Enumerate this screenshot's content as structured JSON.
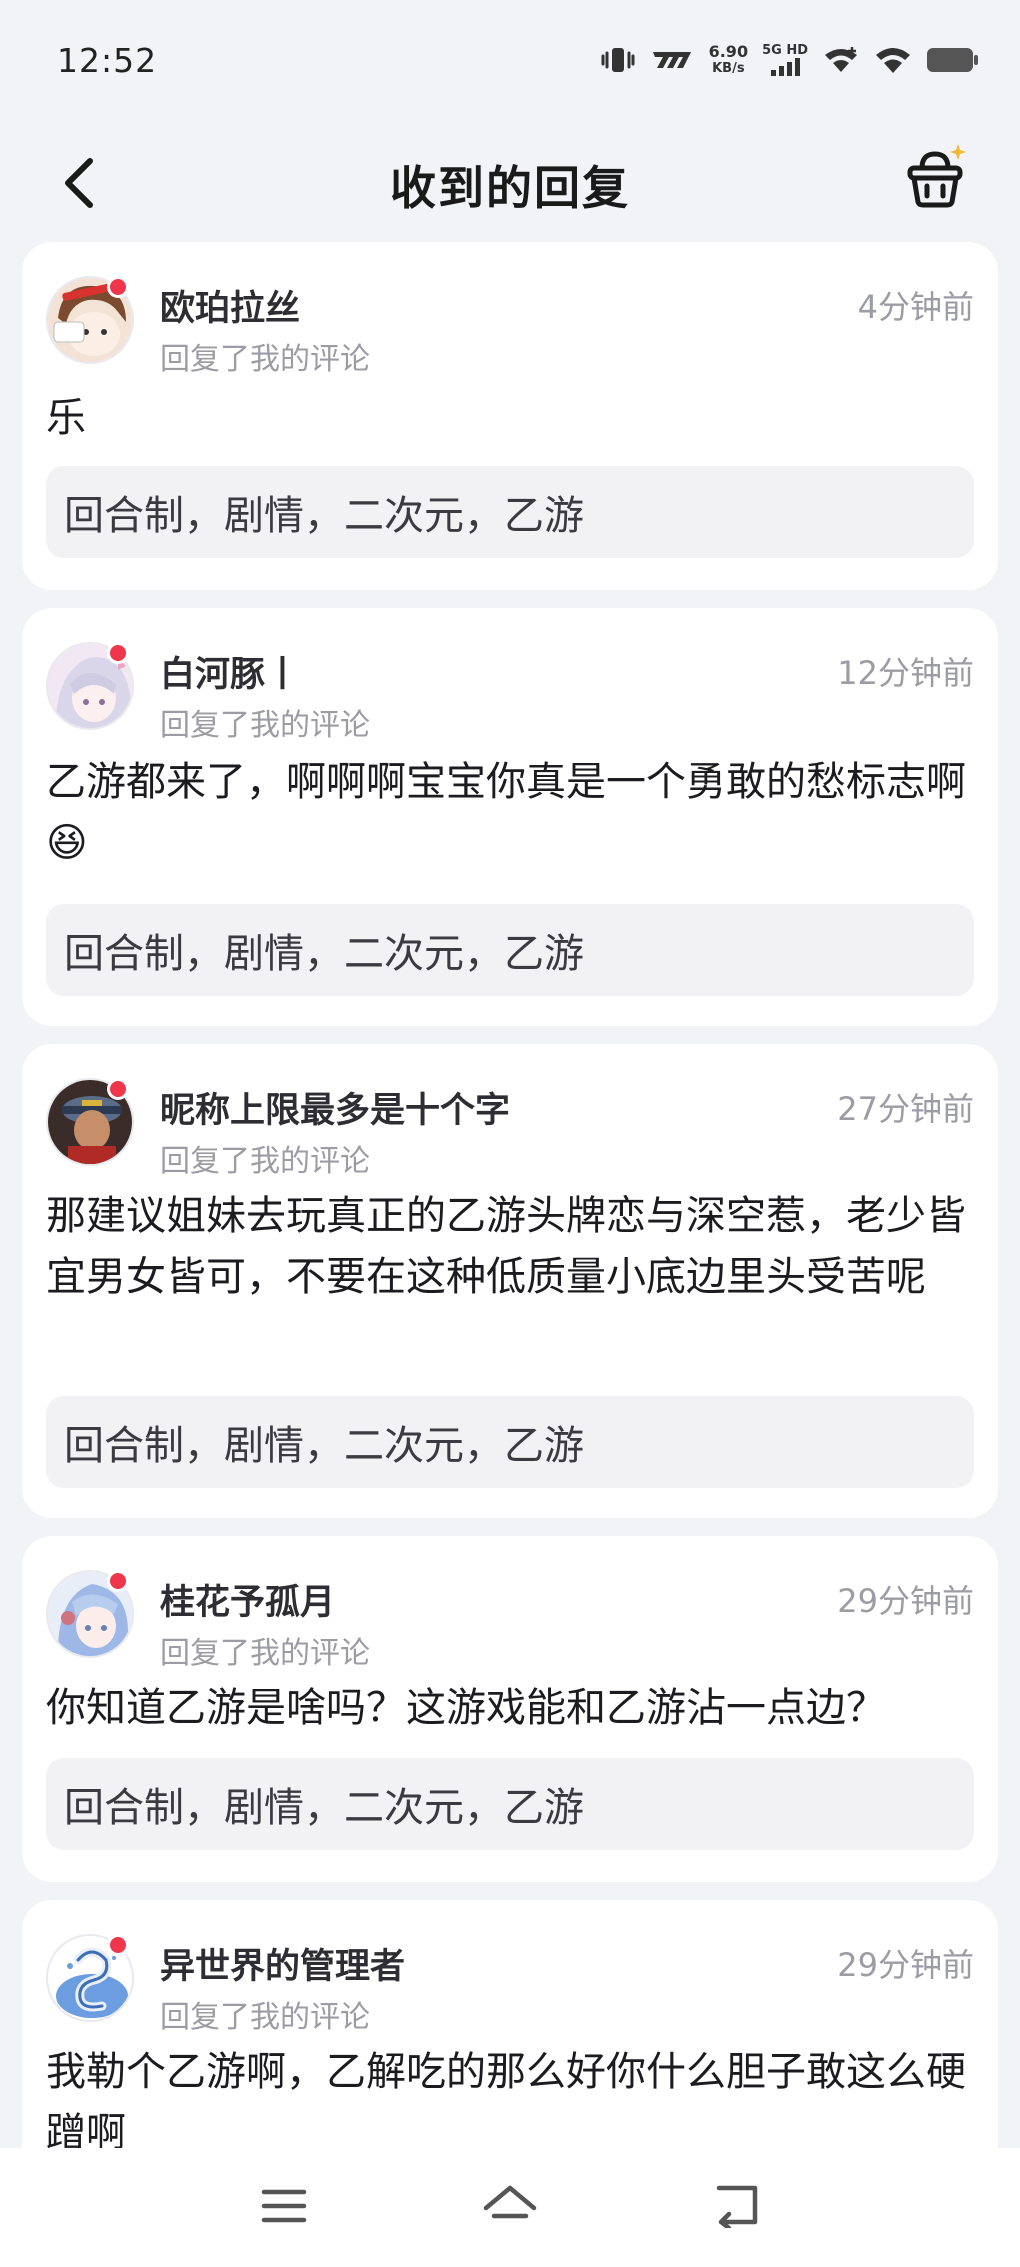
{
  "status_bar": {
    "time": "12:52",
    "net_speed_value": "6.90",
    "net_speed_unit": "KB/s",
    "signal_label": "5G HD",
    "icons": [
      "vibrate-icon",
      "nfc-icon",
      "signal-icon",
      "wifi-call-icon",
      "wifi-icon",
      "battery-icon"
    ]
  },
  "header": {
    "title": "收到的回复",
    "back_icon": "chevron-left-icon",
    "action_icon": "basket-icon"
  },
  "reply_label": "回复了我的评论",
  "replies": [
    {
      "user": "欧珀拉丝",
      "time": "4分钟前",
      "label": "回复了我的评论",
      "text": "乐",
      "quote": "回合制，剧情，二次元，乙游"
    },
    {
      "user": "白河豚丨",
      "time": "12分钟前",
      "label": "回复了我的评论",
      "text": "乙游都来了，啊啊啊宝宝你真是一个勇敢的愁标志啊😆",
      "quote": "回合制，剧情，二次元，乙游"
    },
    {
      "user": "昵称上限最多是十个字",
      "time": "27分钟前",
      "label": "回复了我的评论",
      "text": "那建议姐妹去玩真正的乙游头牌恋与深空惹，老少皆宜男女皆可，不要在这种低质量小底边里头受苦呢",
      "quote": "回合制，剧情，二次元，乙游"
    },
    {
      "user": "桂花予孤月",
      "time": "29分钟前",
      "label": "回复了我的评论",
      "text": "你知道乙游是啥吗？这游戏能和乙游沾一点边？",
      "quote": "回合制，剧情，二次元，乙游"
    },
    {
      "user": "异世界的管理者",
      "time": "29分钟前",
      "label": "回复了我的评论",
      "text": "我勒个乙游啊，乙解吃的那么好你什么胆子敢这么硬蹭啊",
      "quote": ""
    }
  ],
  "bottom_nav": {
    "icons": [
      "menu-icon",
      "home-icon",
      "back-icon"
    ]
  },
  "colors": {
    "background": "#f2f3f7",
    "card": "#ffffff",
    "quote_bg": "#f2f2f5",
    "badge_red": "#f0364a",
    "muted_text": "#9c9ca4"
  }
}
